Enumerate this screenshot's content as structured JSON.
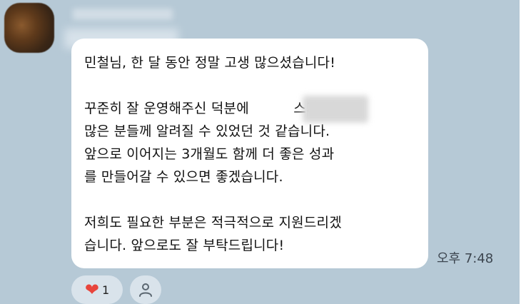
{
  "message": {
    "lines": [
      "민철님, 한 달 동안 정말 고생 많으셨습니다!",
      "",
      "꾸준히 잘 운영해주신 덕분에          스가 더",
      "많은 분들께 알려질 수 있었던 것 같습니다.",
      "앞으로 이어지는 3개월도 함께 더 좋은 성과",
      "를 만들어갈 수 있으면 좋겠습니다.",
      "",
      "저희도 필요한 부분은 적극적으로 지원드리겠",
      "습니다. 앞으로도 잘 부탁드립니다!"
    ],
    "time": "오후 7:48"
  },
  "reactions": {
    "like_icon": "heart-icon",
    "like_count": "1",
    "add_icon": "person-icon"
  },
  "colors": {
    "background": "#b6c9d6",
    "bubble": "#ffffff",
    "heart": "#e8453c"
  }
}
